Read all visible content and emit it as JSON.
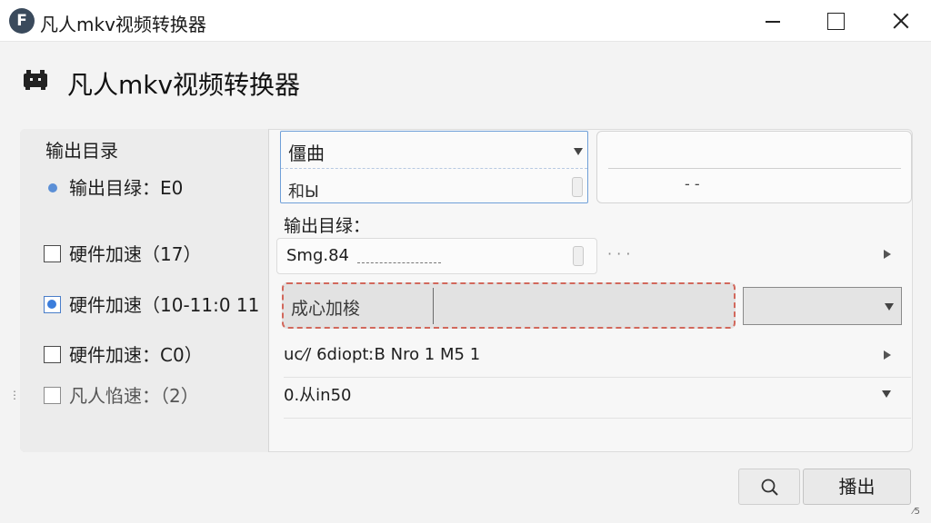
{
  "window": {
    "title": "凡人mkv视频转换器",
    "logo_letter": "F"
  },
  "header": {
    "title": "凡人mkv视频转换器",
    "icon": "gamepad-icon"
  },
  "left_panel": {
    "section_label": "输出目录",
    "options": [
      {
        "label": "输出目绿：E0",
        "control": "dot"
      },
      {
        "label": "硬件加速（17）",
        "control": "checkbox",
        "checked": false
      },
      {
        "label": "硬件加速（10-11:0 11",
        "control": "radio",
        "checked": true
      },
      {
        "label": "硬件加速：C0）",
        "control": "checkbox",
        "checked": false
      },
      {
        "label": "凡人惂速：（2）",
        "control": "checkbox",
        "checked": false
      }
    ]
  },
  "top_dropdown": {
    "value": "僵曲",
    "secondary": "和Ы"
  },
  "side_box": {
    "text": "- -"
  },
  "output": {
    "label": "输出目绿：",
    "path_value": "Smg.84",
    "trailing": "· · ·"
  },
  "accel": {
    "label": "成心加梭"
  },
  "param_rows": [
    {
      "text": "uc⁄/ 6dioptːB  Nro 1        M5         1"
    },
    {
      "text": "0.从in50"
    }
  ],
  "bottom_left_dots": "⋮",
  "buttons": {
    "search": "search-icon",
    "export": "播出"
  },
  "corner_mark": "⁄5"
}
